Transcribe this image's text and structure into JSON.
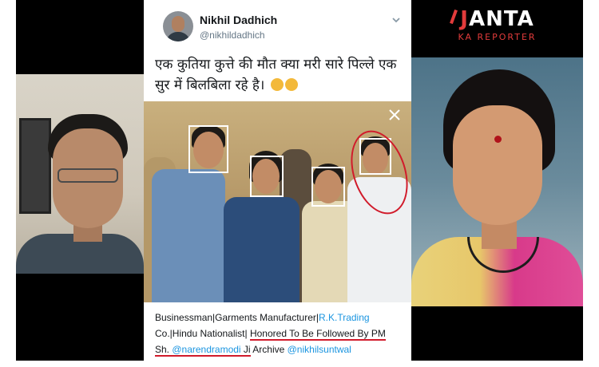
{
  "logo": {
    "title_first": "J",
    "title_rest": "ANTA",
    "subtitle": "KA REPORTER"
  },
  "tweet": {
    "display_name": "Nikhil Dadhich",
    "handle": "@nikhildadhich",
    "text": "एक कुतिया कुत्ते की मौत क्या मरी सारे पिल्ले एक सुर में बिलबिला रहे है।",
    "bio": {
      "part1": "Businessman|Garments Manufacturer|",
      "link1": "R.K.Trading",
      "part2": "Co.|Hindu Nationalist| ",
      "highlight": "Honored To Be Followed By PM",
      "part3": "Sh. ",
      "mention1": "@narendramodi",
      "part4": " Ji",
      "part5": "  Archive ",
      "mention2": "@nikhilsuntwal"
    }
  },
  "icons": {
    "chevron": "chevron-down-icon",
    "close": "close-icon",
    "emoji": "grinning-face-icon"
  },
  "colors": {
    "link": "#1b95e0",
    "annotation_red": "#d11b2b",
    "logo_red": "#e23b3b",
    "name_text": "#14171a",
    "handle_text": "#657786"
  }
}
